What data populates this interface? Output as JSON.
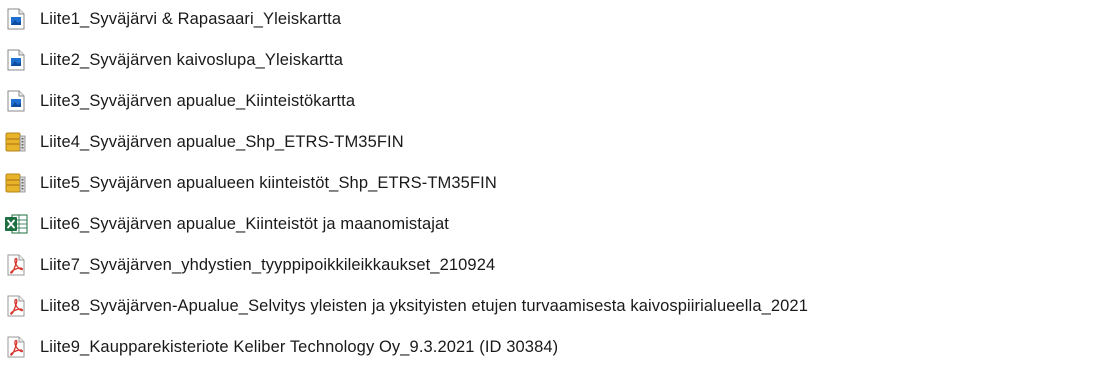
{
  "files": [
    {
      "name": "Liite1_Syväjärvi & Rapasaari_Yleiskartta",
      "icon": "image-file-icon"
    },
    {
      "name": "Liite2_Syväjärven kaivoslupa_Yleiskartta",
      "icon": "image-file-icon"
    },
    {
      "name": "Liite3_Syväjärven apualue_Kiinteistökartta",
      "icon": "image-file-icon"
    },
    {
      "name": "Liite4_Syväjärven apualue_Shp_ETRS-TM35FIN",
      "icon": "zip-archive-icon"
    },
    {
      "name": "Liite5_Syväjärven apualueen kiinteistöt_Shp_ETRS-TM35FIN",
      "icon": "zip-archive-icon"
    },
    {
      "name": "Liite6_Syväjärven apualue_Kiinteistöt ja maanomistajat",
      "icon": "excel-file-icon"
    },
    {
      "name": "Liite7_Syväjärven_yhdystien_tyyppipoikkileikkaukset_210924",
      "icon": "pdf-file-icon"
    },
    {
      "name": "Liite8_Syväjärven-Apualue_Selvitys yleisten ja yksityisten etujen turvaamisesta kaivospiirialueella_2021",
      "icon": "pdf-file-icon"
    },
    {
      "name": "Liite9_Kaupparekisteriote Keliber Technology Oy_9.3.2021 (ID 30384)",
      "icon": "pdf-file-icon"
    }
  ],
  "colors": {
    "image_icon_blue": "#1f6fd1",
    "zip_icon_yellow": "#e8b42a",
    "excel_icon_green": "#1d6f42",
    "pdf_icon_red": "#d6342c"
  }
}
